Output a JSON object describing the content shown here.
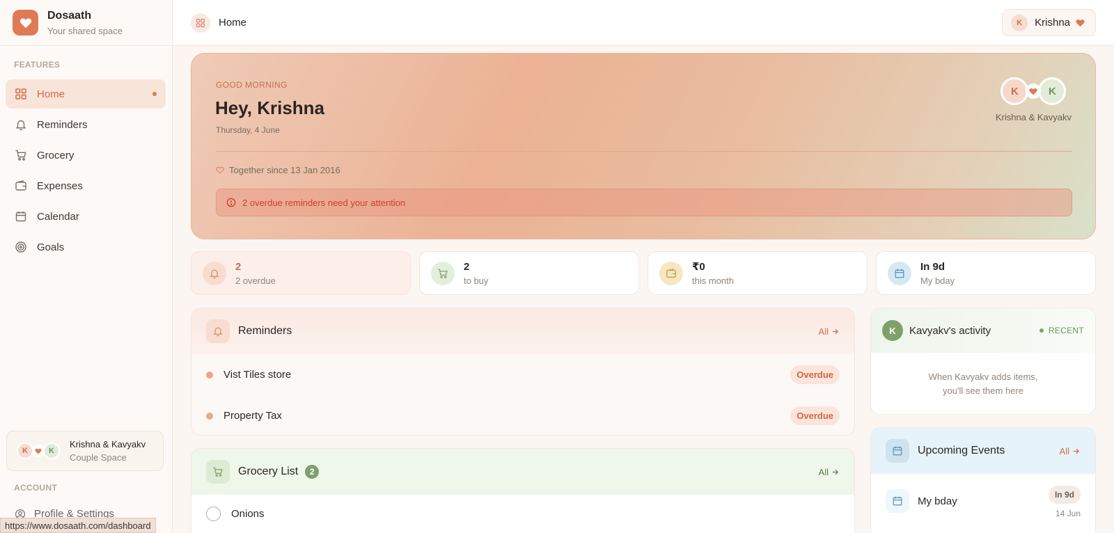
{
  "brand": {
    "name": "Dosaath",
    "subtitle": "Your shared space"
  },
  "sidebar": {
    "features_label": "FEATURES",
    "items": [
      {
        "label": "Home",
        "icon": "grid-icon",
        "active": true
      },
      {
        "label": "Reminders",
        "icon": "bell-icon"
      },
      {
        "label": "Grocery",
        "icon": "cart-icon"
      },
      {
        "label": "Expenses",
        "icon": "wallet-icon"
      },
      {
        "label": "Calendar",
        "icon": "calendar-icon"
      },
      {
        "label": "Goals",
        "icon": "target-icon"
      }
    ],
    "couple": {
      "initial_a": "K",
      "initial_b": "K",
      "name": "Krishna & Kavyakv",
      "subtitle": "Couple Space"
    },
    "account_label": "ACCOUNT",
    "profile_label": "Profile & Settings"
  },
  "topbar": {
    "title": "Home",
    "user_initial": "K",
    "user_name": "Krishna"
  },
  "hero": {
    "greeting": "GOOD MORNING",
    "headline": "Hey, Krishna",
    "date": "Thursday, 4 June",
    "together": "Together since 13 Jan 2016",
    "alert": "2 overdue reminders need your attention",
    "initial_a": "K",
    "initial_b": "K",
    "couple_names": "Krishna & Kavyakv"
  },
  "stats": [
    {
      "value": "2",
      "label": "2 overdue",
      "icon": "bell-icon"
    },
    {
      "value": "2",
      "label": "to buy",
      "icon": "cart-icon"
    },
    {
      "value": "₹0",
      "label": "this month",
      "icon": "wallet-icon"
    },
    {
      "value": "In 9d",
      "label": "My bday",
      "icon": "calendar-icon"
    }
  ],
  "reminders": {
    "title": "Reminders",
    "all_label": "All",
    "items": [
      {
        "title": "Vist Tiles store",
        "status": "Overdue"
      },
      {
        "title": "Property Tax",
        "status": "Overdue"
      }
    ]
  },
  "grocery": {
    "title": "Grocery List",
    "count": "2",
    "all_label": "All",
    "items": [
      {
        "title": "Onions"
      }
    ]
  },
  "activity": {
    "initial": "K",
    "title": "Kavyakv's activity",
    "badge": "RECENT",
    "empty_line1": "When Kavyakv adds items,",
    "empty_line2": "you'll see them here"
  },
  "events": {
    "title": "Upcoming Events",
    "all_label": "All",
    "items": [
      {
        "title": "My bday",
        "badge": "In 9d",
        "date": "14 Jun"
      }
    ]
  },
  "status_url": "https://www.dosaath.com/dashboard",
  "colors": {
    "accent": "#e07a55",
    "green": "#7fa06d",
    "alert": "#cf3e30"
  }
}
